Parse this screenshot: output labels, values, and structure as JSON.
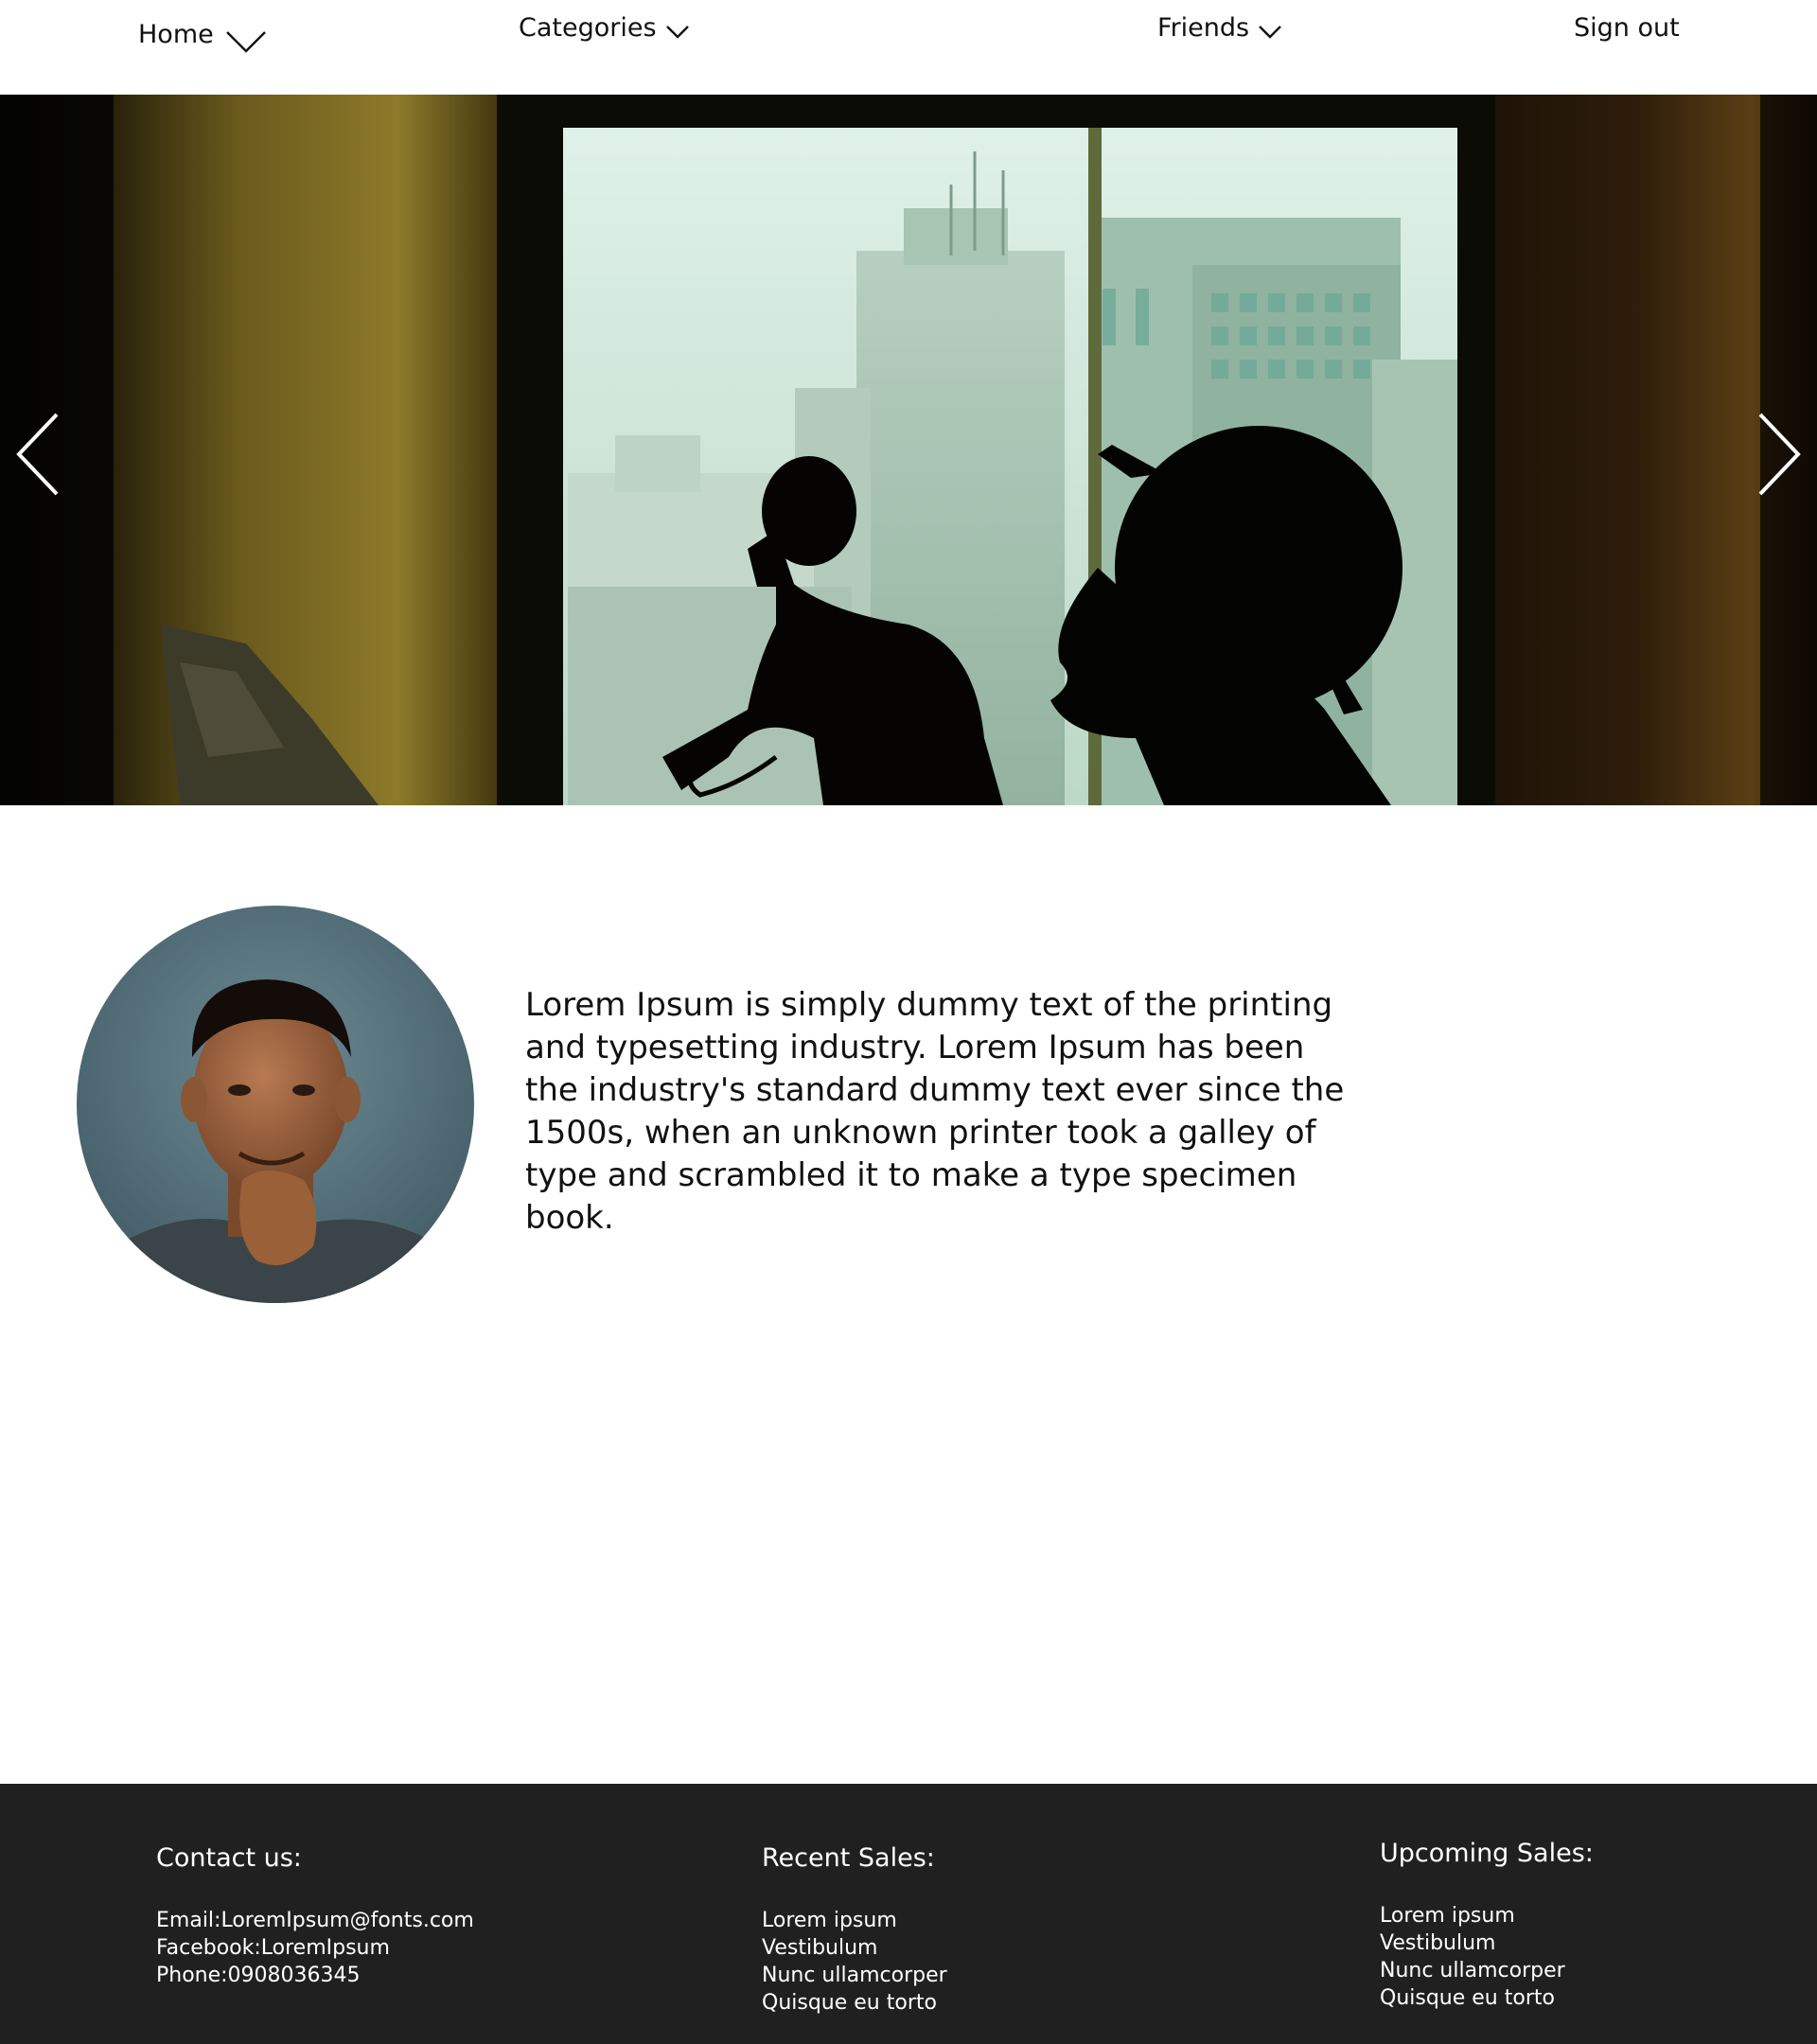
{
  "nav": {
    "home": "Home",
    "categories": "Categories",
    "friends": "Friends",
    "sign_out": "Sign out"
  },
  "hero": {
    "prev_icon": "chevron-left-icon",
    "next_icon": "chevron-right-icon"
  },
  "profile": {
    "bio": "Lorem Ipsum is simply dummy text of the printing and typesetting industry. Lorem Ipsum has been the industry's standard dummy text ever since the 1500s, when an unknown printer took a galley of type and scrambled it to make a type specimen book."
  },
  "footer": {
    "contact": {
      "title": "Contact us:",
      "items": [
        "Email:LoremIpsum@fonts.com",
        "Facebook:LoremIpsum",
        "Phone:0908036345"
      ]
    },
    "recent_sales": {
      "title": "Recent Sales:",
      "items": [
        "Lorem ipsum",
        "Vestibulum",
        "Nunc ullamcorper",
        "Quisque eu torto"
      ]
    },
    "upcoming_sales": {
      "title": "Upcoming Sales:",
      "items": [
        "Lorem ipsum",
        "Vestibulum",
        "Nunc ullamcorper",
        "Quisque eu torto"
      ]
    }
  },
  "colors": {
    "footer_bg": "#202020",
    "text": "#111111"
  }
}
